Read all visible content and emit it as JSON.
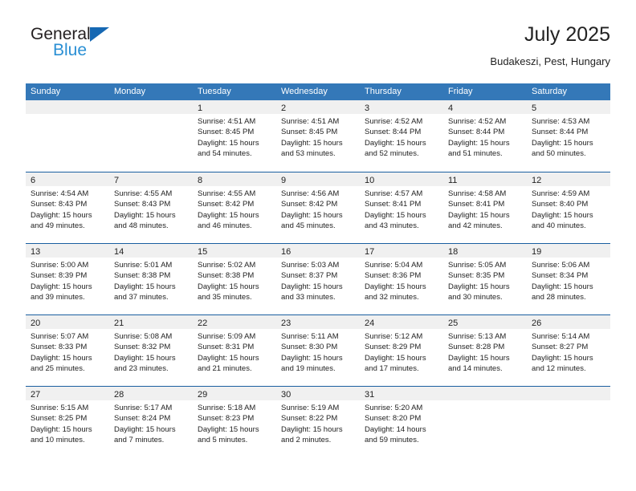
{
  "brand": {
    "name_part1": "General",
    "name_part2": "Blue",
    "triangle_color": "#1668b3",
    "blue_text_color": "#2a8fd4"
  },
  "header": {
    "title": "July 2025",
    "subtitle": "Budakeszi, Pest, Hungary"
  },
  "theme": {
    "header_bar_color": "#3478b8",
    "week_divider_color": "#1a5fa0",
    "day_number_band_color": "#f0f0f0",
    "text_color": "#222222"
  },
  "weekday_headers": [
    "Sunday",
    "Monday",
    "Tuesday",
    "Wednesday",
    "Thursday",
    "Friday",
    "Saturday"
  ],
  "weeks": [
    [
      {
        "day": "",
        "lines": []
      },
      {
        "day": "",
        "lines": []
      },
      {
        "day": "1",
        "lines": [
          "Sunrise: 4:51 AM",
          "Sunset: 8:45 PM",
          "Daylight: 15 hours",
          "and 54 minutes."
        ]
      },
      {
        "day": "2",
        "lines": [
          "Sunrise: 4:51 AM",
          "Sunset: 8:45 PM",
          "Daylight: 15 hours",
          "and 53 minutes."
        ]
      },
      {
        "day": "3",
        "lines": [
          "Sunrise: 4:52 AM",
          "Sunset: 8:44 PM",
          "Daylight: 15 hours",
          "and 52 minutes."
        ]
      },
      {
        "day": "4",
        "lines": [
          "Sunrise: 4:52 AM",
          "Sunset: 8:44 PM",
          "Daylight: 15 hours",
          "and 51 minutes."
        ]
      },
      {
        "day": "5",
        "lines": [
          "Sunrise: 4:53 AM",
          "Sunset: 8:44 PM",
          "Daylight: 15 hours",
          "and 50 minutes."
        ]
      }
    ],
    [
      {
        "day": "6",
        "lines": [
          "Sunrise: 4:54 AM",
          "Sunset: 8:43 PM",
          "Daylight: 15 hours",
          "and 49 minutes."
        ]
      },
      {
        "day": "7",
        "lines": [
          "Sunrise: 4:55 AM",
          "Sunset: 8:43 PM",
          "Daylight: 15 hours",
          "and 48 minutes."
        ]
      },
      {
        "day": "8",
        "lines": [
          "Sunrise: 4:55 AM",
          "Sunset: 8:42 PM",
          "Daylight: 15 hours",
          "and 46 minutes."
        ]
      },
      {
        "day": "9",
        "lines": [
          "Sunrise: 4:56 AM",
          "Sunset: 8:42 PM",
          "Daylight: 15 hours",
          "and 45 minutes."
        ]
      },
      {
        "day": "10",
        "lines": [
          "Sunrise: 4:57 AM",
          "Sunset: 8:41 PM",
          "Daylight: 15 hours",
          "and 43 minutes."
        ]
      },
      {
        "day": "11",
        "lines": [
          "Sunrise: 4:58 AM",
          "Sunset: 8:41 PM",
          "Daylight: 15 hours",
          "and 42 minutes."
        ]
      },
      {
        "day": "12",
        "lines": [
          "Sunrise: 4:59 AM",
          "Sunset: 8:40 PM",
          "Daylight: 15 hours",
          "and 40 minutes."
        ]
      }
    ],
    [
      {
        "day": "13",
        "lines": [
          "Sunrise: 5:00 AM",
          "Sunset: 8:39 PM",
          "Daylight: 15 hours",
          "and 39 minutes."
        ]
      },
      {
        "day": "14",
        "lines": [
          "Sunrise: 5:01 AM",
          "Sunset: 8:38 PM",
          "Daylight: 15 hours",
          "and 37 minutes."
        ]
      },
      {
        "day": "15",
        "lines": [
          "Sunrise: 5:02 AM",
          "Sunset: 8:38 PM",
          "Daylight: 15 hours",
          "and 35 minutes."
        ]
      },
      {
        "day": "16",
        "lines": [
          "Sunrise: 5:03 AM",
          "Sunset: 8:37 PM",
          "Daylight: 15 hours",
          "and 33 minutes."
        ]
      },
      {
        "day": "17",
        "lines": [
          "Sunrise: 5:04 AM",
          "Sunset: 8:36 PM",
          "Daylight: 15 hours",
          "and 32 minutes."
        ]
      },
      {
        "day": "18",
        "lines": [
          "Sunrise: 5:05 AM",
          "Sunset: 8:35 PM",
          "Daylight: 15 hours",
          "and 30 minutes."
        ]
      },
      {
        "day": "19",
        "lines": [
          "Sunrise: 5:06 AM",
          "Sunset: 8:34 PM",
          "Daylight: 15 hours",
          "and 28 minutes."
        ]
      }
    ],
    [
      {
        "day": "20",
        "lines": [
          "Sunrise: 5:07 AM",
          "Sunset: 8:33 PM",
          "Daylight: 15 hours",
          "and 25 minutes."
        ]
      },
      {
        "day": "21",
        "lines": [
          "Sunrise: 5:08 AM",
          "Sunset: 8:32 PM",
          "Daylight: 15 hours",
          "and 23 minutes."
        ]
      },
      {
        "day": "22",
        "lines": [
          "Sunrise: 5:09 AM",
          "Sunset: 8:31 PM",
          "Daylight: 15 hours",
          "and 21 minutes."
        ]
      },
      {
        "day": "23",
        "lines": [
          "Sunrise: 5:11 AM",
          "Sunset: 8:30 PM",
          "Daylight: 15 hours",
          "and 19 minutes."
        ]
      },
      {
        "day": "24",
        "lines": [
          "Sunrise: 5:12 AM",
          "Sunset: 8:29 PM",
          "Daylight: 15 hours",
          "and 17 minutes."
        ]
      },
      {
        "day": "25",
        "lines": [
          "Sunrise: 5:13 AM",
          "Sunset: 8:28 PM",
          "Daylight: 15 hours",
          "and 14 minutes."
        ]
      },
      {
        "day": "26",
        "lines": [
          "Sunrise: 5:14 AM",
          "Sunset: 8:27 PM",
          "Daylight: 15 hours",
          "and 12 minutes."
        ]
      }
    ],
    [
      {
        "day": "27",
        "lines": [
          "Sunrise: 5:15 AM",
          "Sunset: 8:25 PM",
          "Daylight: 15 hours",
          "and 10 minutes."
        ]
      },
      {
        "day": "28",
        "lines": [
          "Sunrise: 5:17 AM",
          "Sunset: 8:24 PM",
          "Daylight: 15 hours",
          "and 7 minutes."
        ]
      },
      {
        "day": "29",
        "lines": [
          "Sunrise: 5:18 AM",
          "Sunset: 8:23 PM",
          "Daylight: 15 hours",
          "and 5 minutes."
        ]
      },
      {
        "day": "30",
        "lines": [
          "Sunrise: 5:19 AM",
          "Sunset: 8:22 PM",
          "Daylight: 15 hours",
          "and 2 minutes."
        ]
      },
      {
        "day": "31",
        "lines": [
          "Sunrise: 5:20 AM",
          "Sunset: 8:20 PM",
          "Daylight: 14 hours",
          "and 59 minutes."
        ]
      },
      {
        "day": "",
        "lines": []
      },
      {
        "day": "",
        "lines": []
      }
    ]
  ]
}
